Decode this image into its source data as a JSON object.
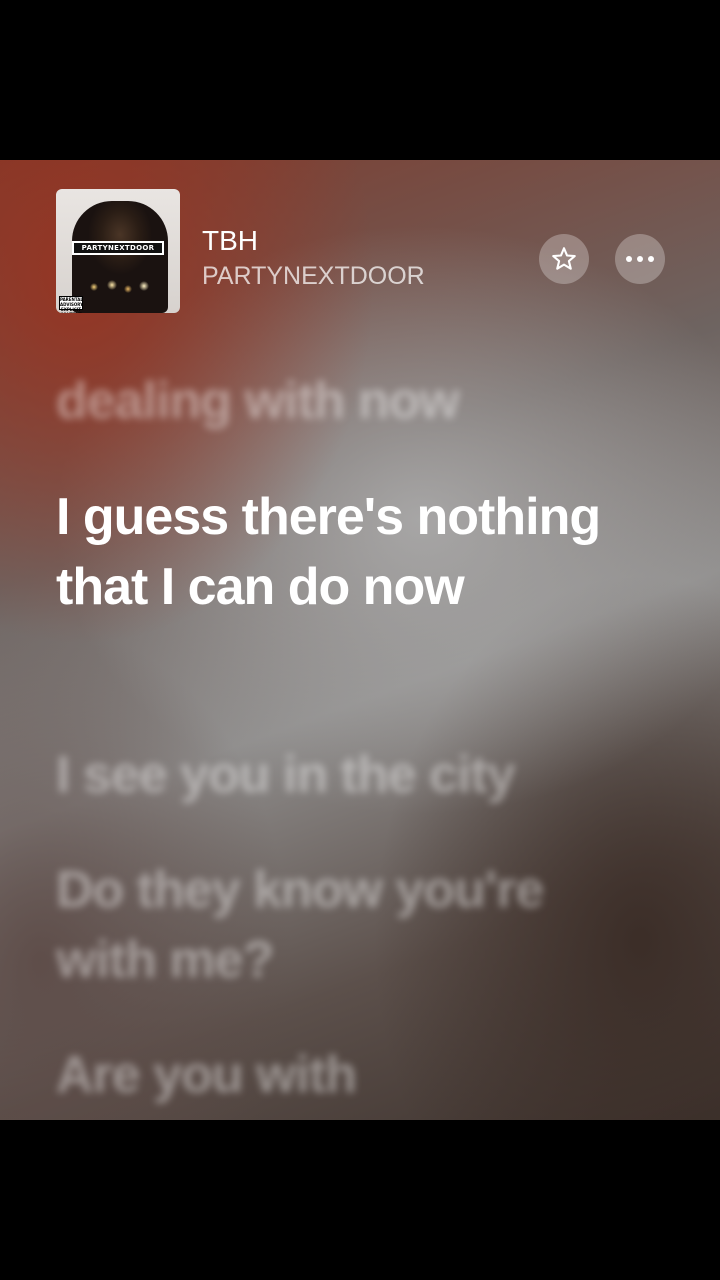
{
  "now_playing": {
    "title": "TBH",
    "artist": "PARTYNEXTDOOR",
    "album_art": {
      "banner_text": "PARTYNEXTDOOR",
      "advisory_text": "PARENTAL ADVISORY EXPLICIT CONTENT"
    },
    "favorite_icon": "star-outline-icon",
    "more_icon": "ellipsis-icon"
  },
  "lyrics": {
    "previous": "dealing with now",
    "current": "I guess there's nothing that I can do now",
    "next": [
      "I see you in the city",
      "Do they know you're with me?",
      "Are you with"
    ]
  },
  "colors": {
    "text_primary": "#ffffff",
    "button_background": "rgba(255,255,255,0.28)"
  }
}
